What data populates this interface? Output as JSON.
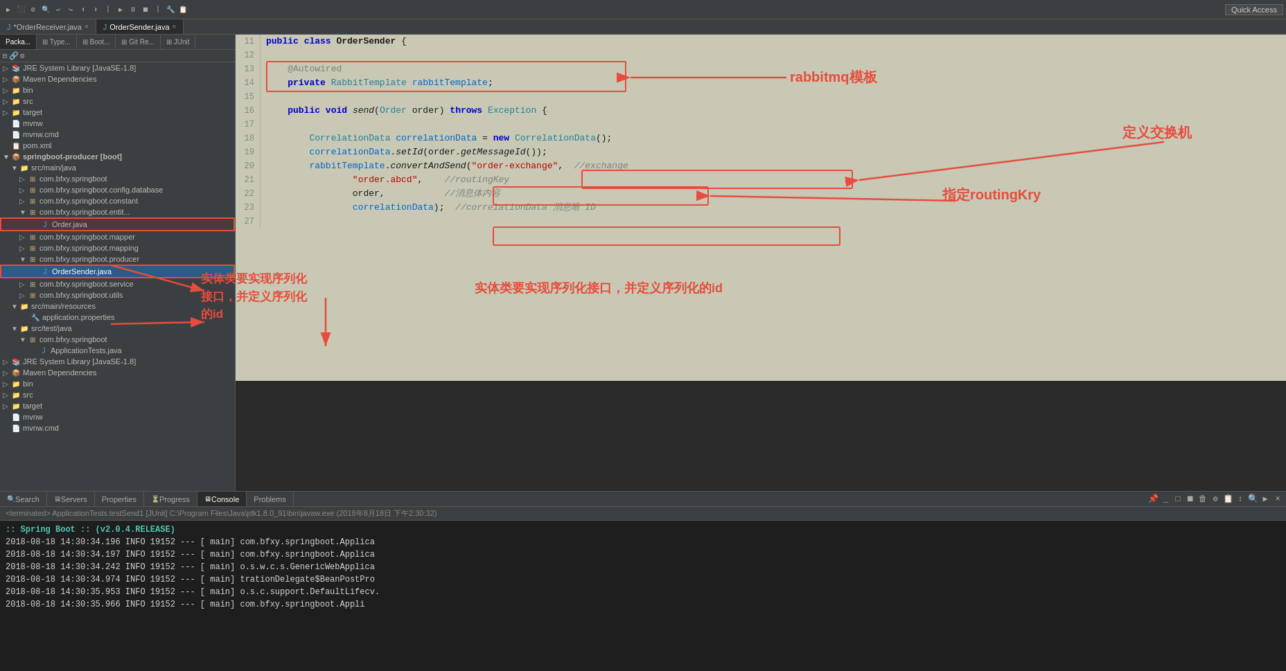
{
  "toolbar": {
    "quick_access": "Quick Access"
  },
  "tabs": [
    {
      "label": "*OrderReceiver.java",
      "active": false
    },
    {
      "label": "OrderSender.java",
      "active": true
    }
  ],
  "sidebar": {
    "tabs": [
      "Packa...",
      "⊞ Type...",
      "⊞ Boot...",
      "⊞ Git Re...",
      "⊞ JUnit"
    ],
    "tree": [
      {
        "indent": 0,
        "type": "lib",
        "label": "JRE System Library [JavaSE-1.8]"
      },
      {
        "indent": 0,
        "type": "lib",
        "label": "Maven Dependencies"
      },
      {
        "indent": 0,
        "type": "folder",
        "label": "bin"
      },
      {
        "indent": 0,
        "type": "folder",
        "label": "src"
      },
      {
        "indent": 0,
        "type": "folder",
        "label": "target"
      },
      {
        "indent": 0,
        "type": "folder",
        "label": "mvnw"
      },
      {
        "indent": 0,
        "type": "file",
        "label": "mvnw.cmd"
      },
      {
        "indent": 0,
        "type": "file",
        "label": "pom.xml"
      },
      {
        "indent": 0,
        "type": "project",
        "label": "springboot-producer [boot]",
        "expanded": true
      },
      {
        "indent": 1,
        "type": "folder",
        "label": "src/main/java",
        "expanded": true
      },
      {
        "indent": 2,
        "type": "pkg",
        "label": "com.bfxy.springboot"
      },
      {
        "indent": 2,
        "type": "pkg",
        "label": "com.bfxy.springboot.config.database"
      },
      {
        "indent": 2,
        "type": "pkg",
        "label": "com.bfxy.springboot.constant"
      },
      {
        "indent": 2,
        "type": "pkg",
        "label": "com.bfxy.springboot.entit...",
        "expanded": true
      },
      {
        "indent": 3,
        "type": "java",
        "label": "Order.java",
        "highlighted": true
      },
      {
        "indent": 2,
        "type": "pkg",
        "label": "com.bfxy.springboot.mapper"
      },
      {
        "indent": 2,
        "type": "pkg",
        "label": "com.bfxy.springboot.mapping"
      },
      {
        "indent": 2,
        "type": "pkg",
        "label": "com.bfxy.springboot.producer",
        "expanded": true
      },
      {
        "indent": 3,
        "type": "java",
        "label": "OrderSender.java",
        "highlighted": true,
        "selected": true
      },
      {
        "indent": 2,
        "type": "pkg",
        "label": "com.bfxy.springboot.service"
      },
      {
        "indent": 2,
        "type": "pkg",
        "label": "com.bfxy.springboot.utils"
      },
      {
        "indent": 1,
        "type": "folder",
        "label": "src/main/resources",
        "expanded": true
      },
      {
        "indent": 2,
        "type": "props",
        "label": "application.properties"
      },
      {
        "indent": 1,
        "type": "folder",
        "label": "src/test/java",
        "expanded": true
      },
      {
        "indent": 2,
        "type": "pkg",
        "label": "com.bfxy.springboot",
        "expanded": true
      },
      {
        "indent": 3,
        "type": "java",
        "label": "ApplicationTests.java"
      },
      {
        "indent": 0,
        "type": "lib",
        "label": "JRE System Library [JavaSE-1.8]"
      },
      {
        "indent": 0,
        "type": "lib",
        "label": "Maven Dependencies"
      },
      {
        "indent": 0,
        "type": "folder",
        "label": "bin"
      },
      {
        "indent": 0,
        "type": "folder",
        "label": "src"
      },
      {
        "indent": 0,
        "type": "folder",
        "label": "target"
      },
      {
        "indent": 0,
        "type": "folder",
        "label": "mvnw"
      },
      {
        "indent": 0,
        "type": "file",
        "label": "mvnw.cmd"
      }
    ]
  },
  "code": {
    "lines": [
      {
        "num": "11",
        "content": "public class OrderSender {"
      },
      {
        "num": "12",
        "content": ""
      },
      {
        "num": "13",
        "content": "    @Autowired"
      },
      {
        "num": "14",
        "content": "    private RabbitTemplate rabbitTemplate;"
      },
      {
        "num": "15",
        "content": ""
      },
      {
        "num": "16",
        "content": "    public void send(Order order) throws Exception {"
      },
      {
        "num": "17",
        "content": ""
      },
      {
        "num": "18",
        "content": "        CorrelationData correlationData = new CorrelationData();"
      },
      {
        "num": "19",
        "content": "        correlationData.setId(order.getMessageId());"
      },
      {
        "num": "20",
        "content": "        rabbitTemplate.convertAndSend(\"order-exchange\",  //exchange"
      },
      {
        "num": "21",
        "content": "                \"order.abcd\",    //routingKey"
      },
      {
        "num": "22",
        "content": "                order,           //消息体内容"
      },
      {
        "num": "23",
        "content": "                correlationData);  //correlationData 消息唯 ID"
      },
      {
        "num": "27",
        "content": ""
      }
    ]
  },
  "annotations": {
    "rabbitmq": "rabbitmq模板",
    "exchange": "定义交换机",
    "routing": "指定routingKry",
    "entity": "实体类要实现序列化接口，并定义序列化的id"
  },
  "bottom": {
    "tabs": [
      "Search",
      "Servers",
      "Properties",
      "Progress",
      "Console",
      "Problems"
    ],
    "active_tab": "Console",
    "console_info": "<terminated> ApplicationTests.testSend1 [JUnit] C:\\Program Files\\Java\\jdk1.8.0_91\\bin\\javaw.exe (2018年8月18日 下午2:30:32)",
    "spring_banner": ":: Spring Boot ::        (v2.0.4.RELEASE)",
    "log_lines": [
      {
        "timestamp": "2018-08-18 14:30:34.196",
        "level": "INFO",
        "pid": "19152",
        "thread": "main",
        "class": "com.bfxy.springboot.Applica"
      },
      {
        "timestamp": "2018-08-18 14:30:34.197",
        "level": "INFO",
        "pid": "19152",
        "thread": "main",
        "class": "com.bfxy.springboot.Applica"
      },
      {
        "timestamp": "2018-08-18 14:30:34.242",
        "level": "INFO",
        "pid": "19152",
        "thread": "main",
        "class": "o.s.w.c.s.GenericWebApplica"
      },
      {
        "timestamp": "2018-08-18 14:30:34.974",
        "level": "INFO",
        "pid": "19152",
        "thread": "main",
        "class": "trationDelegate$BeanPostPro"
      },
      {
        "timestamp": "2018-08-18 14:30:35.953",
        "level": "INFO",
        "pid": "19152",
        "thread": "main",
        "class": "o.s.c.support.DefaultLifecv."
      },
      {
        "timestamp": "2018-08-18 14:30:35.966",
        "level": "INFO",
        "pid": "19152",
        "thread": "main",
        "class": "com.bfxy.springboot.Appli"
      }
    ]
  },
  "colors": {
    "bg_dark": "#3c3f41",
    "bg_code": "#c8c8b4",
    "bg_console": "#1e1e1e",
    "red_annotation": "#e74c3c",
    "accent_blue": "#0066cc"
  }
}
